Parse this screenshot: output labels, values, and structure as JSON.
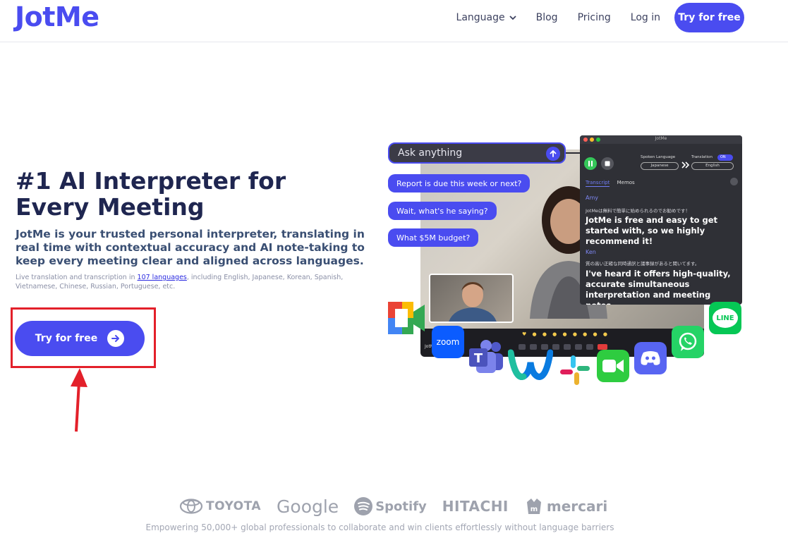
{
  "header": {
    "logo": "JotMe",
    "nav": {
      "language": "Language",
      "blog": "Blog",
      "pricing": "Pricing",
      "login": "Log in",
      "try_free": "Try for free"
    }
  },
  "hero": {
    "title_line1": "#1 AI Interpreter for",
    "title_line2": "Every Meeting",
    "subtitle": "JotMe is your trusted personal interpreter, translating in real time with contextual accuracy and AI note-taking to keep every meeting clear and aligned across languages.",
    "note_prefix": "Live translation and transcription in ",
    "note_link": "107 languages",
    "note_suffix": ", including English, Japanese, Korean, Spanish, Vietnamese, Chinese, Russian, Portuguese, etc.",
    "cta_label": "Try for free"
  },
  "visual": {
    "ask_placeholder": "Ask anything",
    "chips": [
      "Report is due this week or next?",
      "Wait, what's he saying?",
      "What $5M budget?"
    ],
    "panel": {
      "title": "JotMe",
      "spoken_language_label": "Spoken Language",
      "spoken_language_value": "Japanese",
      "translation_label": "Translation",
      "translation_toggle": "ON",
      "translation_value": "English",
      "tab_transcript": "Transcript",
      "tab_memos": "Memos",
      "speaker1": "Amy",
      "speaker1_ja": "JotMeは無料で簡単に始められるのでお勧めです！",
      "speaker1_en": "JotMe is free and easy to get started with, so we highly recommend it!",
      "speaker2": "Ken",
      "speaker2_ja": "質の高い正確な同時通訳と議事録があると聞いてます。",
      "speaker2_en": "I've heard it offers high-quality, accurate simultaneous interpretation and meeting notes."
    },
    "bar_label": "JotMe",
    "apps": {
      "zoom": "zoom",
      "line": "LINE"
    }
  },
  "logos": [
    "TOYOTA",
    "Google",
    "Spotify",
    "HITACHI",
    "mercari"
  ],
  "tagline": "Empowering 50,000+ global professionals to collaborate and win clients effortlessly without language barriers",
  "colors": {
    "brand": "#4a4cf0",
    "annotation_red": "#e3202a"
  }
}
